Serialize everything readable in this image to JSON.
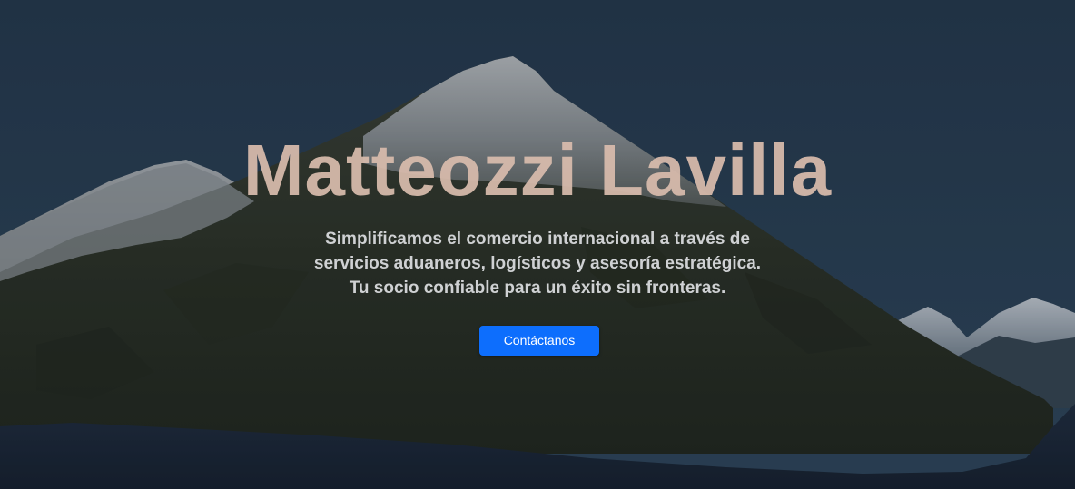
{
  "hero": {
    "title": "Matteozzi Lavilla",
    "subtitle_lines": [
      "Simplificamos el comercio internacional a través de",
      "servicios aduaneros, logísticos y asesoría estratégica.",
      "Tu socio confiable para un éxito sin fronteras."
    ],
    "cta_label": "Contáctanos"
  },
  "colors": {
    "sky": "#25394c",
    "title": "#d9bcad",
    "subtitle": "#cfd1d3",
    "button": "#0d6efd",
    "button_text": "#ffffff",
    "lake": "#1a2536",
    "forest": "#2b3020",
    "snow": "#c9cccf"
  }
}
